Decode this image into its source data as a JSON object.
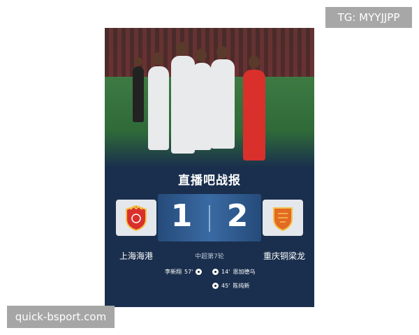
{
  "watermarks": {
    "telegram": "TG: MYYJJPP",
    "site": "quick-bsport.com"
  },
  "card": {
    "brand": "直播吧战报",
    "round": "中超第7轮",
    "home": {
      "name": "上海海港",
      "score": "1",
      "logo_colors": {
        "primary": "#d9302c",
        "accent": "#f3c34a"
      }
    },
    "away": {
      "name": "重庆铜梁龙",
      "score": "2",
      "logo_colors": {
        "primary": "#e36a24",
        "accent": "#f3c34a"
      }
    },
    "events": [
      {
        "side": "home",
        "player": "李新翔",
        "minute": "57'"
      },
      {
        "side": "away",
        "player": "恩加德乌",
        "minute": "14'"
      },
      {
        "side": "away",
        "player": "陈纯新",
        "minute": "45'"
      }
    ]
  }
}
